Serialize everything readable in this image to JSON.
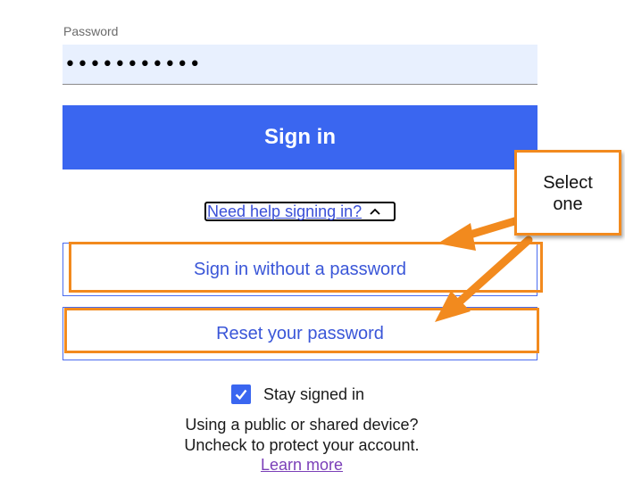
{
  "password": {
    "label": "Password",
    "value": "•••••••••••"
  },
  "signin": {
    "label": "Sign in"
  },
  "help": {
    "label": "Need help signing in?",
    "chevron_icon": "chevron-up-icon"
  },
  "options": {
    "without_password": "Sign in without a password",
    "reset_password": "Reset your password"
  },
  "callout": {
    "text": "Select\none"
  },
  "stay_signed_in": {
    "label": "Stay signed in",
    "checked": true
  },
  "notice": {
    "line1": "Using a public or shared device?",
    "line2": "Uncheck to protect your account."
  },
  "learn_more": {
    "label": "Learn more"
  },
  "colors": {
    "primary": "#3a66f0",
    "input_bg": "#e8f0fe",
    "annotation": "#f28a1e",
    "link": "#3a4fd8",
    "visited_link": "#7b3fb8"
  }
}
